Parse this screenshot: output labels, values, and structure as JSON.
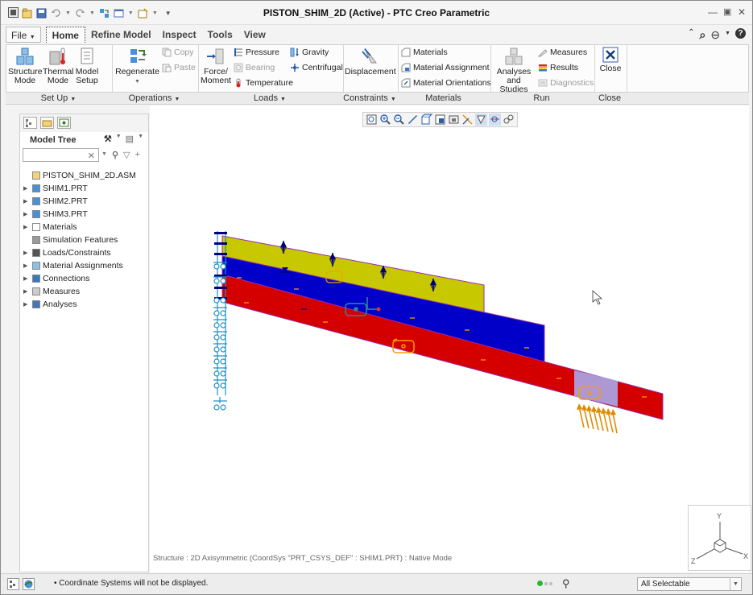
{
  "window": {
    "title": "PISTON_SHIM_2D (Active) - PTC Creo Parametric"
  },
  "menu_tabs": [
    "File",
    "Home",
    "Refine Model",
    "Inspect",
    "Tools",
    "View"
  ],
  "ribbon": {
    "setup": {
      "structure_mode": [
        "Structure",
        "Mode"
      ],
      "thermal_mode": [
        "Thermal",
        "Mode"
      ],
      "model_setup": [
        "Model",
        "Setup"
      ]
    },
    "operations": {
      "regenerate": "Regenerate",
      "copy": "Copy",
      "paste": "Paste"
    },
    "loads": {
      "force_moment": [
        "Force/",
        "Moment"
      ],
      "pressure": "Pressure",
      "bearing": "Bearing",
      "temperature": "Temperature",
      "gravity": "Gravity",
      "centrifugal": "Centrifugal"
    },
    "constraints": {
      "displacement": "Displacement"
    },
    "materials": {
      "materials": "Materials",
      "material_assignment": "Material Assignment",
      "material_orientations": "Material Orientations"
    },
    "run": {
      "analyses_studies": [
        "Analyses",
        "and Studies"
      ],
      "measures": "Measures",
      "results": "Results",
      "diagnostics": "Diagnostics"
    },
    "close": {
      "close": "Close"
    },
    "group_labels": {
      "setup": "Set Up",
      "operations": "Operations",
      "loads": "Loads",
      "constraints": "Constraints",
      "materials": "Materials",
      "run": "Run",
      "close": "Close"
    }
  },
  "model_tree": {
    "title": "Model Tree",
    "search_value": "",
    "nodes": [
      {
        "label": "PISTON_SHIM_2D.ASM",
        "arrow": "",
        "icon": "assembly-icon"
      },
      {
        "label": "SHIM1.PRT",
        "arrow": "▶",
        "icon": "part-icon"
      },
      {
        "label": "SHIM2.PRT",
        "arrow": "▶",
        "icon": "part-icon"
      },
      {
        "label": "SHIM3.PRT",
        "arrow": "▶",
        "icon": "part-icon"
      },
      {
        "label": "Materials",
        "arrow": "▶",
        "icon": "materials-icon"
      },
      {
        "label": "Simulation Features",
        "arrow": "",
        "icon": "simulation-features-icon"
      },
      {
        "label": "Loads/Constraints",
        "arrow": "▶",
        "icon": "loads-constraints-icon"
      },
      {
        "label": "Material Assignments",
        "arrow": "▶",
        "icon": "material-assignments-icon"
      },
      {
        "label": "Connections",
        "arrow": "▶",
        "icon": "connections-icon"
      },
      {
        "label": "Measures",
        "arrow": "▶",
        "icon": "measures-icon"
      },
      {
        "label": "Analyses",
        "arrow": "▶",
        "icon": "analyses-icon"
      }
    ]
  },
  "graphics": {
    "status_text": "Structure : 2D Axisymmetric (CoordSys \"PRT_CSYS_DEF\" : SHIM1.PRT) : Native Mode",
    "triad": {
      "y": "Y",
      "z": "Z",
      "x": "X"
    }
  },
  "status_bar": {
    "message": "• Coordinate Systems will not be displayed.",
    "filter": "All Selectable"
  },
  "colors": {
    "shim1": "#c8c800",
    "shim2": "#0000c8",
    "shim3": "#d40000",
    "constraint": "#1e90c8",
    "load_arrow": "#e08a00",
    "pressure_marker": "#00007a"
  }
}
